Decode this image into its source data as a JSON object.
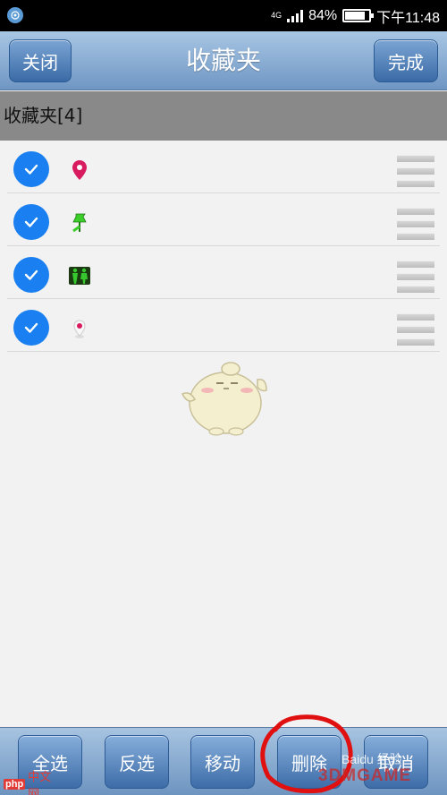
{
  "status_bar": {
    "network": "4G",
    "battery": "84%",
    "battery_fraction": 0.84,
    "time": "下午11:48"
  },
  "header": {
    "close_label": "关闭",
    "title": "收藏夹",
    "done_label": "完成"
  },
  "section": {
    "title": "收藏夹[4]"
  },
  "favorites": [
    {
      "checked": true,
      "icon": "map-pin-icon",
      "color": "#d81b5f"
    },
    {
      "checked": true,
      "icon": "pushpin-icon",
      "color": "#3ccf2a"
    },
    {
      "checked": true,
      "icon": "restroom-icon",
      "color": "#37c82f"
    },
    {
      "checked": true,
      "icon": "small-pin-icon",
      "color": "#d81b5f"
    }
  ],
  "toolbar": {
    "select_all": "全选",
    "invert": "反选",
    "move": "移动",
    "delete": "删除",
    "cancel": "取消"
  },
  "watermarks": {
    "php_badge": "php",
    "php_text": "中文网",
    "brand": "3DMGAME",
    "baidu": "Baidu 经验"
  },
  "colors": {
    "accent": "#1a7ff0",
    "header": "#6f96c3",
    "annotation": "#e01010"
  }
}
